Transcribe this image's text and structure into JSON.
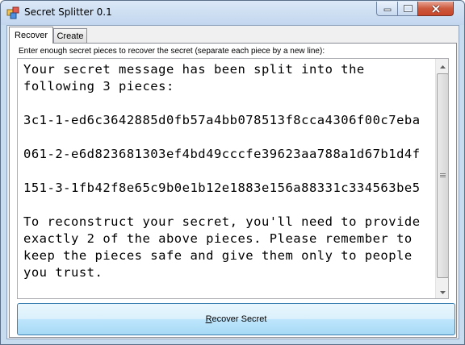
{
  "window": {
    "title": "Secret Splitter 0.1"
  },
  "tabs": [
    {
      "label": "Recover",
      "active": true
    },
    {
      "label": "Create",
      "active": false
    }
  ],
  "recover": {
    "instruction": "Enter enough secret pieces to recover the secret (separate each piece by a new line):",
    "textarea_value": "Your secret message has been split into the\nfollowing 3 pieces:\n\n3c1-1-ed6c3642885d0fb57a4bb078513f8cca4306f00c7eba\n\n061-2-e6d823681303ef4bd49cccfe39623aa788a1d67b1d4f\n\n151-3-1fb42f8e65c9b0e1b12e1883e156a88331c334563be5\n\nTo reconstruct your secret, you'll need to provide\nexactly 2 of the above pieces. Please remember to\nkeep the pieces safe and give them only to people\nyou trust.",
    "button_accel": "R",
    "button_rest": "ecover Secret"
  },
  "colors": {
    "close_button": "#c8452a",
    "button_border": "#3c7fb1",
    "titlebar": "#c2d6ee"
  },
  "icons": {
    "app": "app-window-icon",
    "minimize": "minimize-icon",
    "maximize": "maximize-icon",
    "close": "close-icon"
  }
}
